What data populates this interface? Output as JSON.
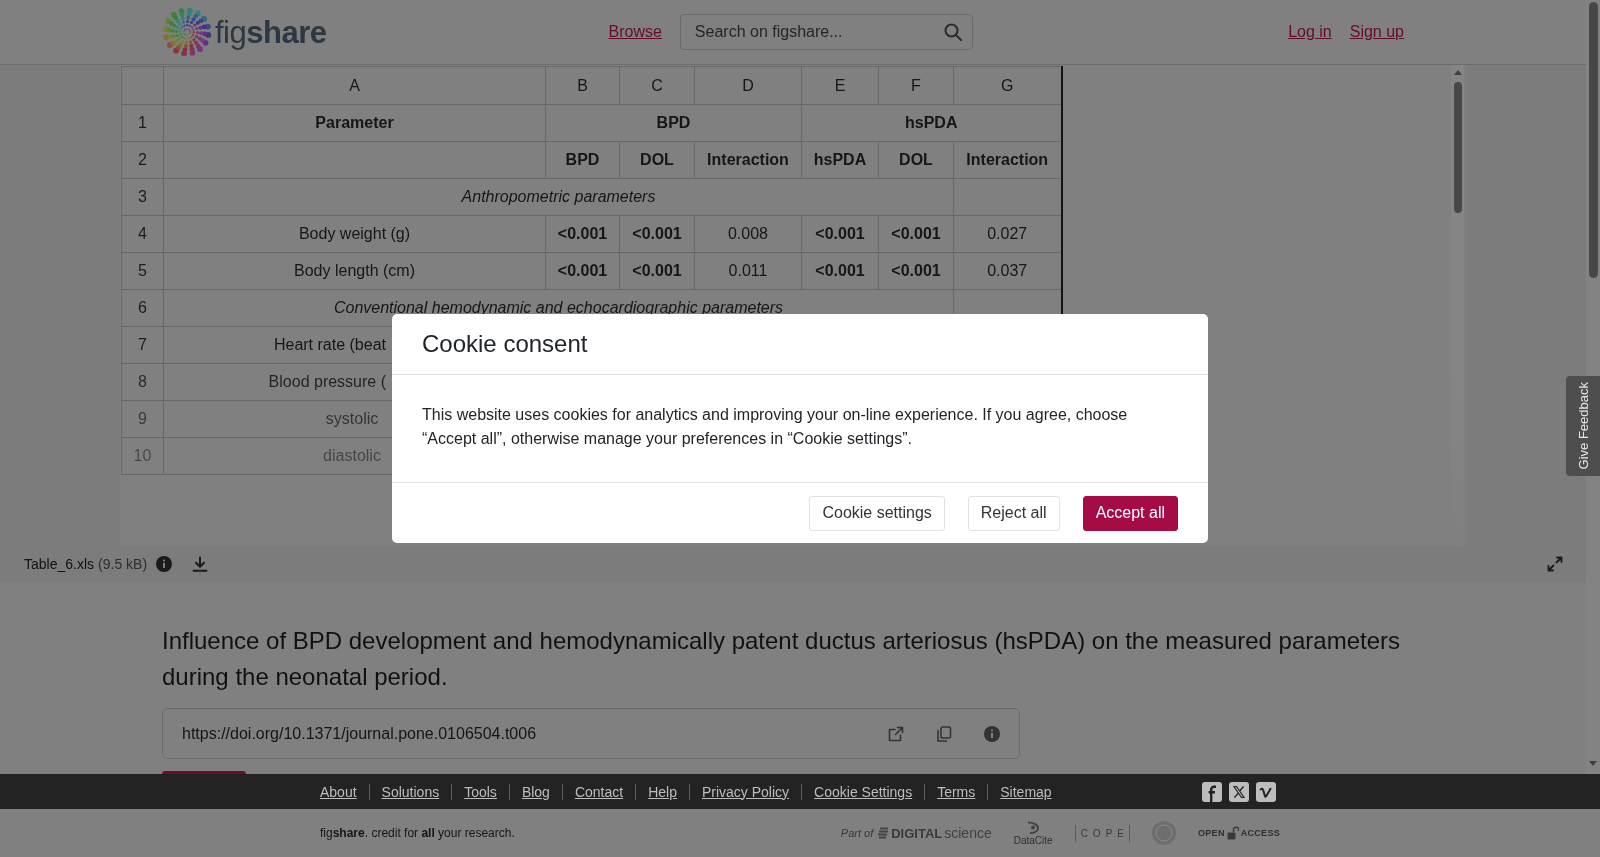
{
  "header": {
    "logo": "fig**share**",
    "nav": [
      "Browse"
    ],
    "search": {
      "placeholder": "Search on figshare..."
    },
    "account_links": [
      "Log in",
      "Sign up"
    ]
  },
  "preview": {
    "spreadsheet": {
      "columns": [
        "A",
        "B",
        "C",
        "D",
        "E",
        "F",
        "G"
      ],
      "rows": [
        {
          "number": "1",
          "cells": [
            {
              "text": "Parameter",
              "kind": "header"
            },
            {
              "text": "BPD",
              "kind": "header",
              "colspan": 3
            },
            {
              "text": "hsPDA",
              "kind": "header",
              "colspan": 3
            }
          ]
        },
        {
          "number": "2",
          "cells": [
            {
              "kind": "blank"
            },
            {
              "text": "BPD",
              "kind": "header"
            },
            {
              "text": "DOL",
              "kind": "header"
            },
            {
              "text": "Interaction",
              "kind": "header"
            },
            {
              "text": "hsPDA",
              "kind": "header"
            },
            {
              "text": "DOL",
              "kind": "header"
            },
            {
              "text": "Interaction",
              "kind": "header"
            }
          ]
        },
        {
          "number": "3",
          "cells": [
            {
              "text": "Anthropometric parameters",
              "kind": "section",
              "colspan": 6
            },
            {
              "kind": "blank"
            }
          ]
        },
        {
          "number": "4",
          "cells": [
            {
              "text": "Body weight (g)",
              "kind": "label"
            },
            {
              "text": "<0.001",
              "kind": "significant"
            },
            {
              "text": "<0.001",
              "kind": "significant"
            },
            {
              "text": "0.008",
              "kind": "value"
            },
            {
              "text": "<0.001",
              "kind": "significant"
            },
            {
              "text": "<0.001",
              "kind": "significant"
            },
            {
              "text": "0.027",
              "kind": "value"
            }
          ]
        },
        {
          "number": "5",
          "cells": [
            {
              "text": "Body length (cm)",
              "kind": "label"
            },
            {
              "text": "<0.001",
              "kind": "significant"
            },
            {
              "text": "<0.001",
              "kind": "significant"
            },
            {
              "text": "0.011",
              "kind": "value"
            },
            {
              "text": "<0.001",
              "kind": "significant"
            },
            {
              "text": "<0.001",
              "kind": "significant"
            },
            {
              "text": "0.037",
              "kind": "value"
            }
          ]
        },
        {
          "number": "6",
          "cells": [
            {
              "text": "Conventional hemodynamic and echocardiographic parameters",
              "kind": "section",
              "colspan": 6
            },
            {
              "kind": "blank"
            }
          ]
        },
        {
          "number": "7",
          "cells": [
            {
              "text": "Heart rate (beat",
              "kind": "label"
            }
          ]
        },
        {
          "number": "8",
          "cells": [
            {
              "text": "Blood pressure (",
              "kind": "label"
            }
          ]
        },
        {
          "number": "9",
          "cells": [
            {
              "text": "systolic",
              "kind": "label"
            }
          ]
        },
        {
          "number": "10",
          "cells": [
            {
              "text": "diastolic",
              "kind": "label"
            }
          ]
        }
      ]
    },
    "file": {
      "name": "Table_6.xls",
      "size": "(9.5 kB)"
    }
  },
  "item": {
    "title": "Influence of BPD development and hemodynamically patent ductus arteriosus (hsPDA) on the measured parameters during the neonatal period.",
    "doi": "https://doi.org/10.1371/journal.pone.0106504.t006"
  },
  "footer": {
    "links": [
      "About",
      "Solutions",
      "Tools",
      "Blog",
      "Contact",
      "Help",
      "Privacy Policy",
      "Cookie Settings",
      "Terms",
      "Sitemap"
    ],
    "tagline": "fig**share**. credit for **all** your research.",
    "partners": [
      {
        "kind": "digital-science",
        "prefix": "Part of",
        "name_bold": "DIGITAL",
        "name_light": "science"
      },
      {
        "kind": "datacite",
        "name": "DataCite"
      },
      {
        "kind": "cope",
        "name": "COPE"
      },
      {
        "kind": "seal"
      },
      {
        "kind": "open-access",
        "name_left": "OPEN",
        "name_right": "ACCESS"
      }
    ]
  },
  "feedback": {
    "label": "Give Feedback"
  },
  "cookie_dialog": {
    "title": "Cookie consent",
    "message": "This website uses cookies for analytics and improving your on-line experience. If you agree, choose “Accept all”, otherwise manage your preferences in “Cookie settings”.",
    "buttons": [
      {
        "label": "Cookie settings",
        "kind": "secondary"
      },
      {
        "label": "Reject all",
        "kind": "secondary"
      },
      {
        "label": "Accept all",
        "kind": "primary"
      }
    ]
  }
}
